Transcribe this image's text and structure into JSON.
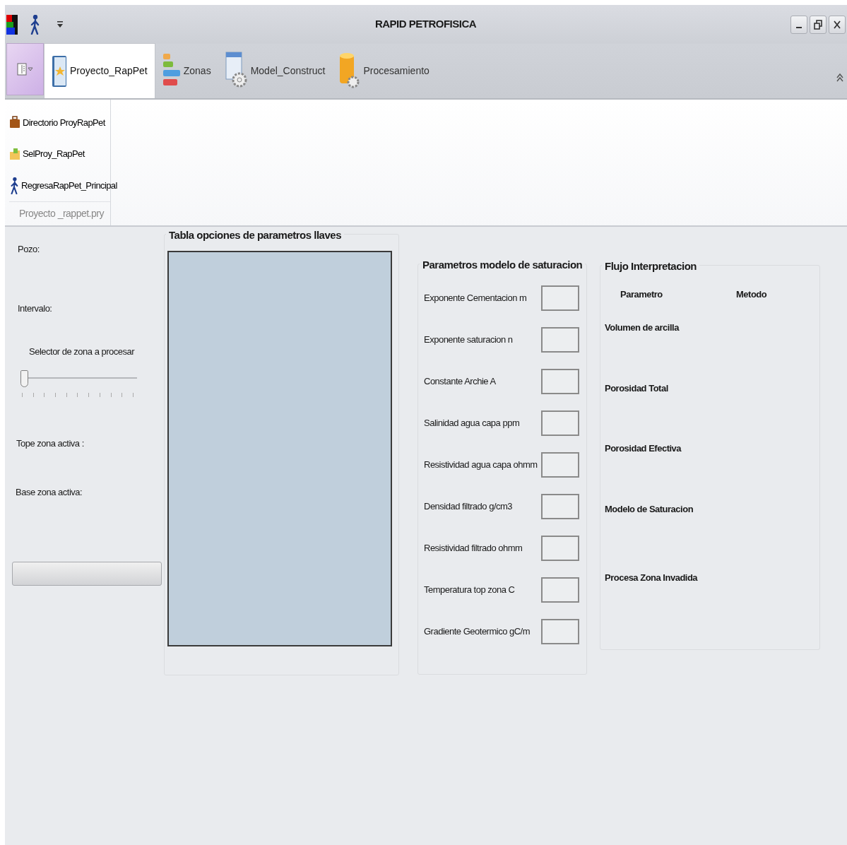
{
  "window": {
    "title": "RAPID  PETROFISICA"
  },
  "tabs": [
    {
      "label": "Proyecto_RapPet",
      "selected": true
    },
    {
      "label": "Zonas",
      "selected": false
    },
    {
      "label": "Model_Construct",
      "selected": false
    },
    {
      "label": "Procesamiento",
      "selected": false
    }
  ],
  "ribbon": {
    "group_label": "Proyecto _rappet.pry",
    "items": [
      {
        "label": "Directorio ProyRapPet"
      },
      {
        "label": "SelProy_RapPet"
      },
      {
        "label": "RegresaRapPet_Principal"
      }
    ]
  },
  "left_panel": {
    "pozo": "Pozo:",
    "intervalo": "Intervalo:",
    "slider_label": "Selector de zona a procesar",
    "slider": {
      "level": 0
    },
    "tope": "Tope zona activa :",
    "base": "Base zona activa:"
  },
  "table_group": {
    "title": "Tabla opciones de parametros llaves"
  },
  "saturation_group": {
    "title": "Parametros modelo de saturacion",
    "fields": [
      {
        "label": "Exponente Cementacion  m"
      },
      {
        "label": "Exponente saturacion n"
      },
      {
        "label": "Constante Archie A"
      },
      {
        "label": "Salinidad agua capa ppm"
      },
      {
        "label": "Resistividad agua capa ohmm"
      },
      {
        "label": "Densidad filtrado g/cm3"
      },
      {
        "label": "Resistividad  filtrado ohmm"
      },
      {
        "label": "Temperatura top zona C"
      },
      {
        "label": "Gradiente Geotermico gC/m"
      }
    ]
  },
  "flow_group": {
    "title": "Flujo Interpretacion",
    "headers": [
      "Parametro",
      "Metodo"
    ],
    "rows": [
      "Volumen  de arcilla",
      "Porosidad Total",
      "Porosidad Efectiva",
      "Modelo de Saturacion",
      "Procesa Zona Invadida"
    ]
  }
}
